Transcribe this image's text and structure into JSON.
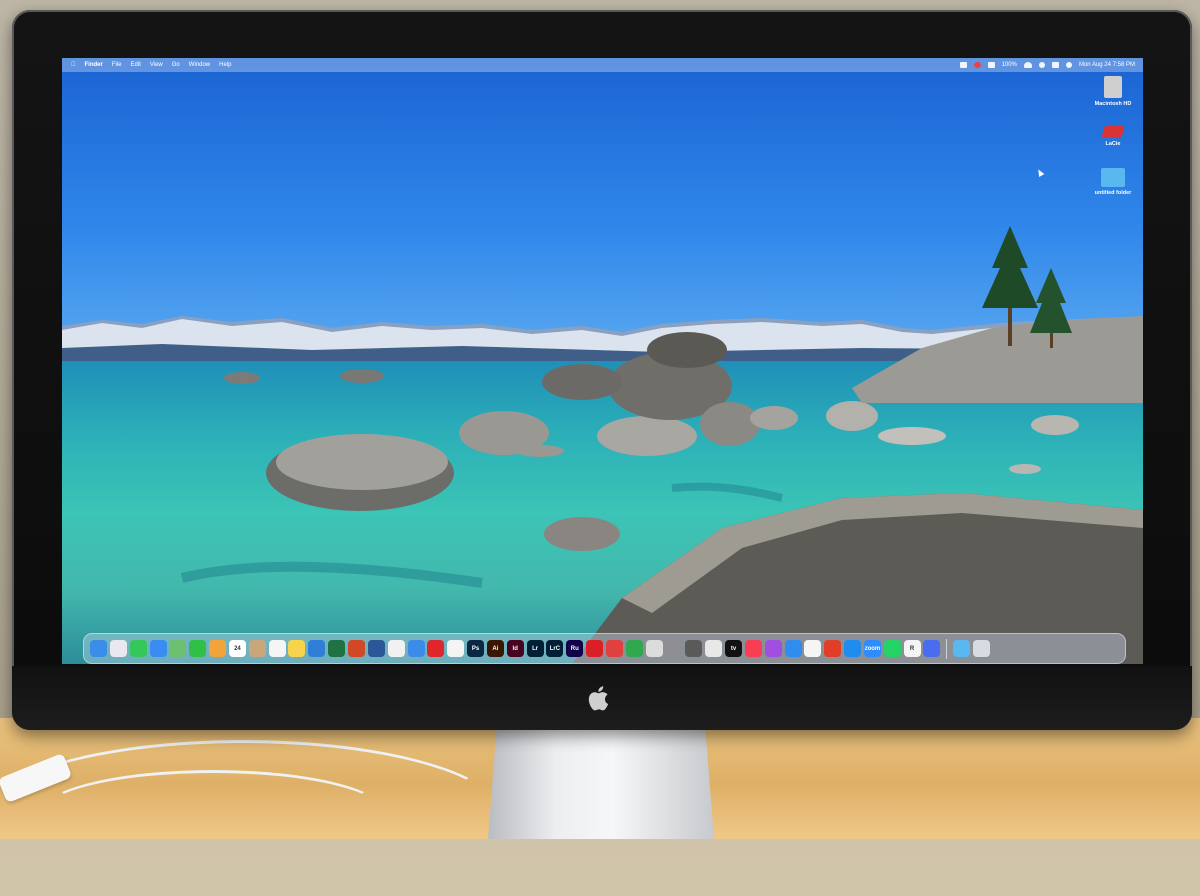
{
  "menubar": {
    "apple": "",
    "app_name": "Finder",
    "menus": [
      "File",
      "Edit",
      "View",
      "Go",
      "Window",
      "Help"
    ],
    "battery": "100%",
    "clock": "Mon Aug 24  7:58 PM"
  },
  "desktop_icons": [
    {
      "label": "Macintosh HD",
      "icon": "hard-drive-icon",
      "color": "#c8c8c8"
    },
    {
      "label": "LaCie",
      "icon": "external-drive-icon",
      "color": "#d83434"
    },
    {
      "label": "untitled folder",
      "icon": "folder-icon",
      "color": "#5ab8f0"
    }
  ],
  "dock": {
    "apps": [
      {
        "icon": "finder-icon",
        "color": "#3b8ee8",
        "text": ""
      },
      {
        "icon": "launchpad-icon",
        "color": "#e8e8ee",
        "text": ""
      },
      {
        "icon": "messages-icon",
        "color": "#34c759",
        "text": ""
      },
      {
        "icon": "mail-icon",
        "color": "#3a8df0",
        "text": ""
      },
      {
        "icon": "maps-icon",
        "color": "#6cc070",
        "text": ""
      },
      {
        "icon": "facetime-icon",
        "color": "#30c048",
        "text": ""
      },
      {
        "icon": "photos-icon",
        "color": "#f2a33a",
        "text": ""
      },
      {
        "icon": "calendar-icon",
        "color": "#ffffff",
        "text": "24"
      },
      {
        "icon": "contacts-icon",
        "color": "#c9a77a",
        "text": ""
      },
      {
        "icon": "reminders-icon",
        "color": "#f5f5f5",
        "text": ""
      },
      {
        "icon": "notes-icon",
        "color": "#f7d44c",
        "text": ""
      },
      {
        "icon": "freeform-icon",
        "color": "#2f7fd8",
        "text": ""
      },
      {
        "icon": "excel-icon",
        "color": "#1f7244",
        "text": ""
      },
      {
        "icon": "powerpoint-icon",
        "color": "#d24726",
        "text": ""
      },
      {
        "icon": "word-icon",
        "color": "#2b5797",
        "text": ""
      },
      {
        "icon": "chrome-icon",
        "color": "#f1f1f1",
        "text": ""
      },
      {
        "icon": "safari-icon",
        "color": "#3d8be9",
        "text": ""
      },
      {
        "icon": "acrobat-icon",
        "color": "#e0262a",
        "text": ""
      },
      {
        "icon": "acrobat-reader-icon",
        "color": "#f4f4f4",
        "text": ""
      },
      {
        "icon": "photoshop-icon",
        "color": "#0a2744",
        "text": "Ps"
      },
      {
        "icon": "illustrator-icon",
        "color": "#3a1500",
        "text": "Ai"
      },
      {
        "icon": "indesign-icon",
        "color": "#49021f",
        "text": "Id"
      },
      {
        "icon": "lightroom-icon",
        "color": "#001e36",
        "text": "Lr"
      },
      {
        "icon": "lightroom-classic-icon",
        "color": "#001e36",
        "text": "LrC"
      },
      {
        "icon": "rush-icon",
        "color": "#13004a",
        "text": "Ru"
      },
      {
        "icon": "creative-cloud-icon",
        "color": "#da1f26",
        "text": ""
      },
      {
        "icon": "quicken-icon",
        "color": "#e04040",
        "text": ""
      },
      {
        "icon": "numbers-icon",
        "color": "#2fa84f",
        "text": ""
      },
      {
        "icon": "preview-icon",
        "color": "#dcdcdc",
        "text": ""
      },
      {
        "icon": "system-settings-icon",
        "color": "#8e8e93",
        "text": ""
      },
      {
        "icon": "calculator-icon",
        "color": "#5a5a5a",
        "text": ""
      },
      {
        "icon": "screenshot-icon",
        "color": "#e8e8e8",
        "text": ""
      },
      {
        "icon": "apple-tv-icon",
        "color": "#111111",
        "text": "tv"
      },
      {
        "icon": "music-icon",
        "color": "#fa3c55",
        "text": ""
      },
      {
        "icon": "podcasts-icon",
        "color": "#a14fe0",
        "text": ""
      },
      {
        "icon": "keynote-icon",
        "color": "#2f8df0",
        "text": ""
      },
      {
        "icon": "news-icon",
        "color": "#f5f5f5",
        "text": ""
      },
      {
        "icon": "pencil-app-icon",
        "color": "#e23d28",
        "text": ""
      },
      {
        "icon": "app-store-icon",
        "color": "#1f8cf0",
        "text": ""
      },
      {
        "icon": "zoom-icon",
        "color": "#2d8cff",
        "text": "zoom"
      },
      {
        "icon": "whatsapp-icon",
        "color": "#25d366",
        "text": ""
      },
      {
        "icon": "r-app-icon",
        "color": "#f5f5f5",
        "text": "R"
      },
      {
        "icon": "remote-desktop-icon",
        "color": "#4a6cf0",
        "text": ""
      }
    ],
    "right": [
      {
        "icon": "downloads-folder-icon",
        "color": "#5ab8f0"
      },
      {
        "icon": "trash-icon",
        "color": "#d8dbe0"
      }
    ]
  }
}
